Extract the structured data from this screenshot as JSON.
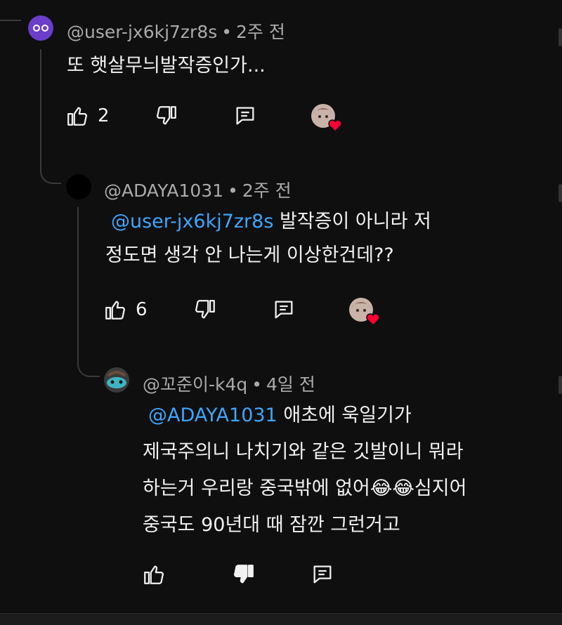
{
  "comments": [
    {
      "handle": "@user-jx6kj7zr8s",
      "time": "2주 전",
      "mention": "",
      "lines": [
        "또 햇살무늬발작증인가..."
      ],
      "likes": "2",
      "avatar_color": "#6a3ec9"
    },
    {
      "handle": "@ADAYA1031",
      "time": "2주 전",
      "mention": "@user-jx6kj7zr8s",
      "line1_rest": " 발작증이 아니라 저",
      "line2": "정도면 생각 안 나는게 이상한건데??",
      "likes": "6",
      "avatar_color": "#000000"
    },
    {
      "handle": "@꼬준이-k4q",
      "time": "4일 전",
      "mention": "@ADAYA1031",
      "line1_rest": " 애초에 욱일기가",
      "line2": "제국주의니 나치기와 같은 깃발이니 뭐라",
      "line3": "하는거 우리랑 중국밖에 없어😂😂심지어",
      "line4": "중국도 90년대 때 잠깐 그런거고",
      "likes": "",
      "avatar_color": "#3a3a3a"
    }
  ],
  "icons": {
    "like": "thumbs-up-icon",
    "dislike": "thumbs-down-icon",
    "reply": "reply-icon",
    "creator_heart": "creator-heart-icon"
  },
  "colors": {
    "background": "#0f0f0f",
    "text": "#f1f1f1",
    "secondary_text": "#aaaaaa",
    "mention": "#3ea6ff",
    "heart": "#ff0033"
  }
}
